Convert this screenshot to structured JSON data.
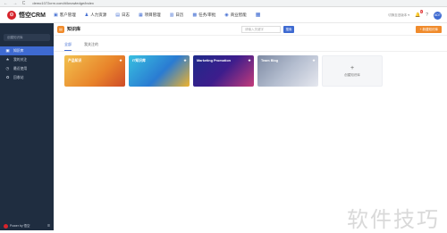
{
  "browser": {
    "nav": "← → C",
    "url": "demo1072crm.com/#/knowledge/index"
  },
  "header": {
    "logo_mark": "⊙",
    "logo_text": "悟空CRM",
    "menu": [
      {
        "icon": "▣",
        "label": "客户管理"
      },
      {
        "icon": "♟",
        "label": "人力资源"
      },
      {
        "icon": "▤",
        "label": "日志"
      },
      {
        "icon": "▦",
        "label": "项目管理"
      },
      {
        "icon": "▥",
        "label": "日历"
      },
      {
        "icon": "▩",
        "label": "任务/审批"
      },
      {
        "icon": "◉",
        "label": "商业智能"
      }
    ],
    "apps_icon": "▦",
    "right_text": "切换至旧版本 ▾",
    "bell_icon": "🔔",
    "bell_badge": "9",
    "help_icon": "?",
    "user_avatar": "ADT"
  },
  "sidebar": {
    "search_placeholder": "创建知识库",
    "items": [
      {
        "icon": "▣",
        "label": "知识库",
        "active": true
      },
      {
        "icon": "★",
        "label": "我的关注",
        "active": false
      },
      {
        "icon": "◷",
        "label": "最近使用",
        "active": false
      },
      {
        "icon": "♻",
        "label": "回收站",
        "active": false
      }
    ],
    "footer_text": "Power by 悟空",
    "collapse_icon": "≡"
  },
  "main": {
    "head_icon": "▤",
    "head_title": "知识库",
    "search_placeholder": "请输入关键字",
    "search_button": "搜索",
    "new_button": "+ 新建知识库",
    "tabs": [
      {
        "label": "全部",
        "active": true
      },
      {
        "label": "我关注的",
        "active": false
      }
    ],
    "cards": [
      {
        "title": "产品知识",
        "fav": "★"
      },
      {
        "title": "IT知识库",
        "fav": "★"
      },
      {
        "title": "Marketing Promotion",
        "fav": "★"
      },
      {
        "title": "Team Blog",
        "fav": "★"
      }
    ],
    "add_card": {
      "plus": "+",
      "label": "创建知识库"
    }
  },
  "watermark": "软件技巧",
  "colors": {
    "accent": "#3e6ad1",
    "sidebar_bg": "#1f2d40",
    "brand_red": "#d6232b",
    "orange": "#f08b2c"
  }
}
